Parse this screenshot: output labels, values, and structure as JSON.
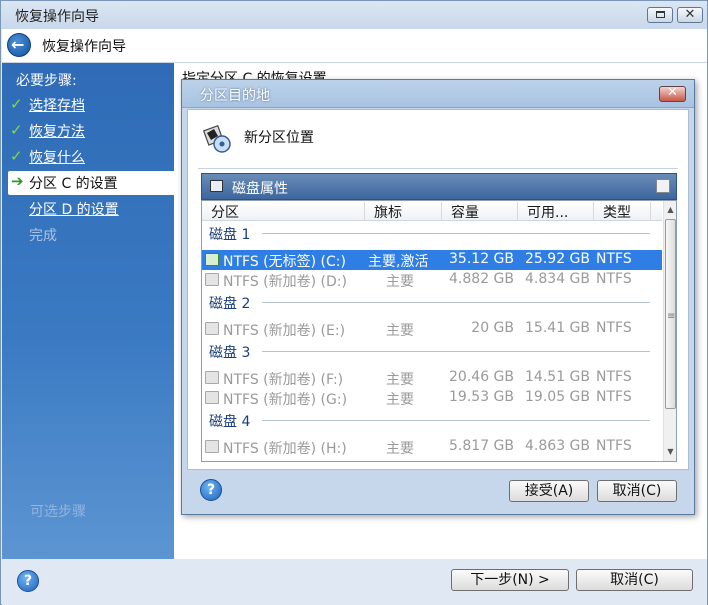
{
  "window": {
    "title": "恢复操作向导",
    "header_title": "恢复操作向导"
  },
  "sidebar": {
    "steps_title": "必要步骤:",
    "steps": [
      {
        "label": "选择存档",
        "state": "done"
      },
      {
        "label": "恢复方法",
        "state": "done"
      },
      {
        "label": "恢复什么",
        "state": "done"
      },
      {
        "label": "分区 C 的设置",
        "state": "current"
      },
      {
        "label": "分区 D 的设置",
        "state": "todo"
      },
      {
        "label": "完成",
        "state": "disabled"
      }
    ],
    "optional_title": "可选步骤"
  },
  "main": {
    "title": "指定分区 C 的恢复设置"
  },
  "footer": {
    "next_label": "下一步(N) >",
    "cancel_label": "取消(C)"
  },
  "dialog": {
    "title": "分区目的地",
    "subtitle": "新分区位置",
    "disk_properties_label": "磁盘属性",
    "columns": [
      "分区",
      "旗标",
      "容量",
      "可用...",
      "类型"
    ],
    "disks": [
      {
        "label": "磁盘 1",
        "partitions": [
          {
            "name": "NTFS (无标签) (C:)",
            "flags": "主要,激活",
            "capacity": "35.12 GB",
            "free": "25.92 GB",
            "type": "NTFS",
            "selected": true
          },
          {
            "name": "NTFS (新加卷) (D:)",
            "flags": "主要",
            "capacity": "4.882 GB",
            "free": "4.834 GB",
            "type": "NTFS",
            "selected": false
          }
        ]
      },
      {
        "label": "磁盘 2",
        "partitions": [
          {
            "name": "NTFS (新加卷) (E:)",
            "flags": "主要",
            "capacity": "20 GB",
            "free": "15.41 GB",
            "type": "NTFS",
            "selected": false
          }
        ]
      },
      {
        "label": "磁盘 3",
        "partitions": [
          {
            "name": "NTFS (新加卷) (F:)",
            "flags": "主要",
            "capacity": "20.46 GB",
            "free": "14.51 GB",
            "type": "NTFS",
            "selected": false
          },
          {
            "name": "NTFS (新加卷) (G:)",
            "flags": "主要",
            "capacity": "19.53 GB",
            "free": "19.05 GB",
            "type": "NTFS",
            "selected": false
          }
        ]
      },
      {
        "label": "磁盘 4",
        "partitions": [
          {
            "name": "NTFS (新加卷) (H:)",
            "flags": "主要",
            "capacity": "5.817 GB",
            "free": "4.863 GB",
            "type": "NTFS",
            "selected": false
          }
        ]
      }
    ],
    "accept_label": "接受(A)",
    "cancel_label": "取消(C)"
  },
  "colors": {
    "sidebar": "#3a7ac3",
    "selection": "#2f7ee5",
    "disk_label": "#1a3e7a"
  }
}
